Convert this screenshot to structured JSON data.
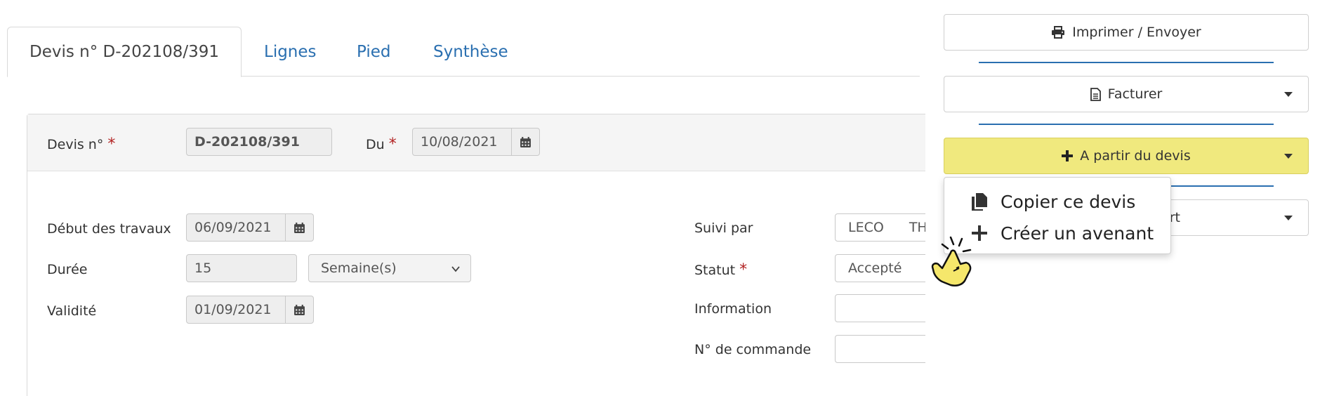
{
  "tabs": {
    "devis": "Devis n° D-202108/391",
    "lignes": "Lignes",
    "pied": "Pied",
    "synthese": "Synthèse"
  },
  "header": {
    "devis_label": "Devis n°",
    "devis_value": "D-202108/391",
    "du_label": "Du",
    "du_value": "10/08/2021"
  },
  "form": {
    "debut_label": "Début des travaux",
    "debut_value": "06/09/2021",
    "duree_label": "Durée",
    "duree_value": "15",
    "duree_unit": "Semaine(s)",
    "validite_label": "Validité",
    "validite_value": "01/09/2021",
    "suivi_label": "Suivi par",
    "suivi_value_1": "LECO",
    "suivi_value_2": "TH",
    "statut_label": "Statut",
    "statut_value": "Accepté",
    "information_label": "Information",
    "commande_label": "N° de commande"
  },
  "sidebar": {
    "imprimer": "Imprimer / Envoyer",
    "facturer": "Facturer",
    "a_partir": "A partir du devis",
    "hidden_partial": "rt"
  },
  "dropdown": {
    "items": [
      "Copier ce devis",
      "Créer un avenant"
    ]
  },
  "colors": {
    "link": "#2a6fb0",
    "required": "#b22222",
    "accent_button": "#f0e97e"
  }
}
